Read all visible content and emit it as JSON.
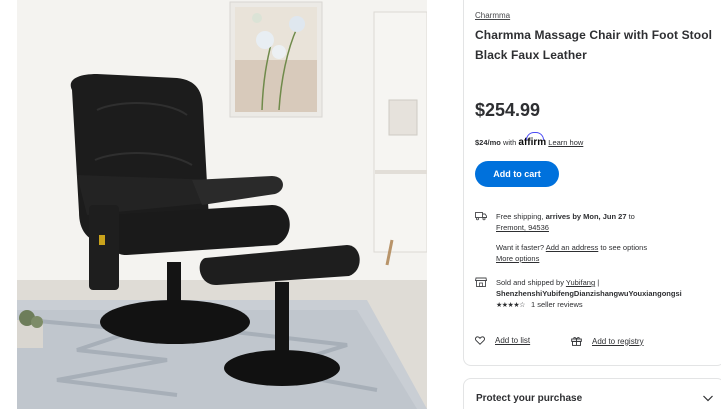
{
  "product": {
    "brand": "Charmma",
    "title": "Charmma Massage Chair with Foot Stool Black Faux Leather",
    "price": "$254.99"
  },
  "financing": {
    "monthly": "$24/mo",
    "with_text": "with",
    "provider": "affirm",
    "learn_more": "Learn how"
  },
  "actions": {
    "add_to_cart": "Add to cart",
    "add_to_list": "Add to list",
    "add_to_registry": "Add to registry"
  },
  "shipping": {
    "free_shipping": "Free shipping,",
    "arrives": "arrives by Mon, Jun 27",
    "to": "to",
    "location": "Fremont, 94536",
    "want_faster": "Want it faster?",
    "add_address": "Add an address",
    "see_options": "to see options",
    "more_options": "More options"
  },
  "seller": {
    "sold_by": "Sold and shipped by",
    "seller_short": "Yubifang",
    "separator": "|",
    "seller_full": "ShenzhenshiYubifengDianzishangwuYouxiangongsi",
    "stars": "★★★★☆",
    "reviews": "1 seller reviews"
  },
  "protect": {
    "title": "Protect your purchase"
  },
  "colors": {
    "primary_blue": "#0071dc",
    "affirm_blue": "#4a4af4",
    "text": "#2e2f32"
  },
  "icons": [
    "truck-icon",
    "store-icon",
    "heart-icon",
    "gift-icon",
    "chevron-down-icon"
  ]
}
